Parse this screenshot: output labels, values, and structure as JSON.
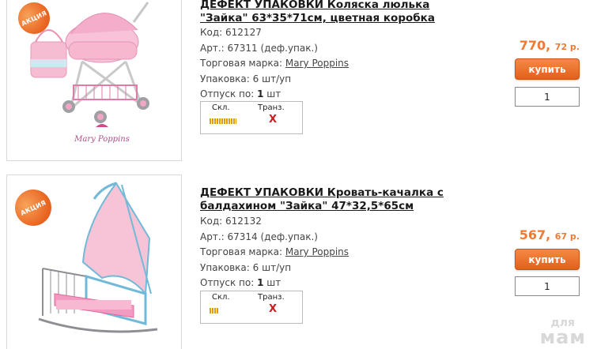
{
  "products": [
    {
      "badge": "АКЦИЯ",
      "title_line1": "ДЕФЕКТ УПАКОВКИ Коляска люлька",
      "title_line2": "\"Зайка\" 63*35*71см, цветная коробка",
      "code_label": "Код:",
      "code": "612127",
      "art_label": "Арт.:",
      "art": "67311 (деф.упак.)",
      "brand_label": "Торговая марка:",
      "brand": "Mary Poppins",
      "pack_label": "Упаковка:",
      "pack": "6 шт/уп",
      "release_label": "Отпуск по:",
      "release_num": "1",
      "release_unit": "шт",
      "stock_warehouse": "Скл.",
      "stock_transit": "Транз.",
      "transit_mark": "X",
      "warehouse_level": 0.9,
      "price_main": "770,",
      "price_cents": "72 р.",
      "buy_label": "купить",
      "qty": "1",
      "logo_text": "Mary Poppins"
    },
    {
      "badge": "АКЦИЯ",
      "title_line1": "ДЕФЕКТ УПАКОВКИ Кровать-качалка с",
      "title_line2": "балдахином \"Зайка\" 47*32,5*65см",
      "code_label": "Код:",
      "code": "612132",
      "art_label": "Арт.:",
      "art": "67314 (деф.упак.)",
      "brand_label": "Торговая марка:",
      "brand": "Mary Poppins",
      "pack_label": "Упаковка:",
      "pack": "6 шт/уп",
      "release_label": "Отпуск по:",
      "release_num": "1",
      "release_unit": "шт",
      "stock_warehouse": "Скл.",
      "stock_transit": "Транз.",
      "transit_mark": "X",
      "warehouse_level": 0.3,
      "price_main": "567,",
      "price_cents": "67 р.",
      "buy_label": "купить",
      "qty": "1"
    }
  ],
  "watermark": {
    "line1": "для",
    "line2": "мам"
  },
  "colors": {
    "accent": "#ef7a33",
    "button": "#e8692a",
    "stock_bar": "#e29a0b",
    "transit_x": "#d0191f"
  }
}
